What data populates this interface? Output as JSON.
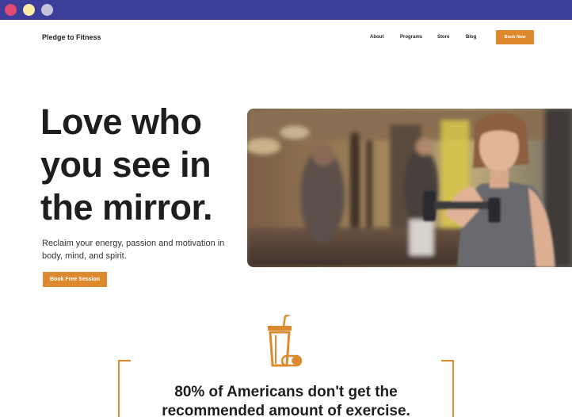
{
  "window": {
    "controls": [
      "close",
      "minimize",
      "maximize"
    ]
  },
  "nav": {
    "brand": "Pledge to Fitness",
    "links": [
      "About",
      "Programs",
      "Store",
      "Blog"
    ],
    "cta": "Book Now"
  },
  "hero": {
    "headline": "Love who you see in the mirror.",
    "subtext": "Reclaim your energy, passion and motivation in body, mind, and spirit.",
    "cta": "Book Free Session",
    "image_icon": "gym-photo"
  },
  "stats": {
    "icon": "drink-cup-icon",
    "headline": "80% of Americans don't get the recommended amount of exercise."
  },
  "colors": {
    "titlebar": "#3d3d9a",
    "accent": "#dd8a2e",
    "text": "#1e1e1e"
  }
}
